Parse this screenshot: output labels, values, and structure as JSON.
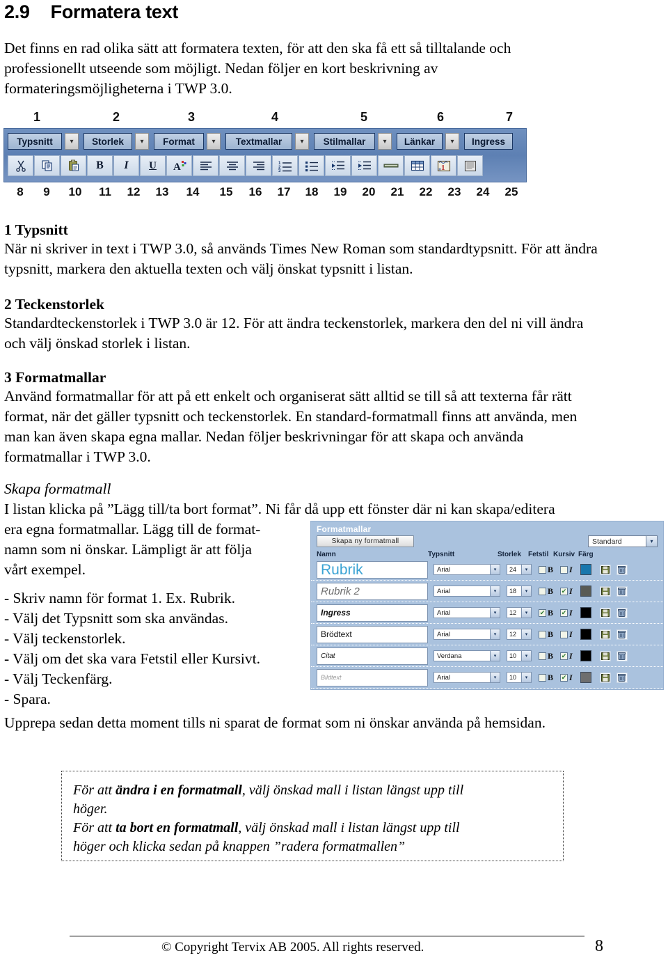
{
  "document": {
    "section_number": "2.9",
    "section_title": "Formatera text",
    "intro": "Det finns en rad olika sätt att formatera texten, för att den ska få ett så tilltalande och professionellt utseende som möjligt. Nedan följer en kort beskrivning av formateringsmöjligheterna i TWP 3.0."
  },
  "toolbar": {
    "top_numbers": [
      "1",
      "2",
      "3",
      "4",
      "5",
      "6",
      "7"
    ],
    "bottom_numbers": [
      "8",
      "9",
      "10",
      "11",
      "12",
      "13",
      "14",
      "15",
      "16",
      "17",
      "18",
      "19",
      "20",
      "21",
      "22",
      "23",
      "24",
      "25"
    ],
    "dropdowns": [
      {
        "label": "Typsnitt",
        "has_arrow": true
      },
      {
        "label": "Storlek",
        "has_arrow": true
      },
      {
        "label": "Format",
        "has_arrow": true
      },
      {
        "label": "Textmallar",
        "has_arrow": true
      },
      {
        "label": "Stilmallar",
        "has_arrow": true
      },
      {
        "label": "Länkar",
        "has_arrow": true
      },
      {
        "label": "Ingress",
        "has_arrow": false
      }
    ],
    "buttons": [
      "cut-scissors-icon",
      "copy-icon",
      "paste-clipboard-icon",
      "bold-icon",
      "italic-icon",
      "underline-icon",
      "font-color-icon",
      "align-left-icon",
      "align-center-icon",
      "align-right-icon",
      "numbered-list-icon",
      "bulleted-list-icon",
      "decrease-indent-icon",
      "increase-indent-icon",
      "horizontal-rule-icon",
      "insert-table-icon",
      "insert-image-icon",
      "page-properties-icon"
    ]
  },
  "sections": [
    {
      "heading": "1 Typsnitt",
      "body": "När ni skriver in text i TWP 3.0, så används Times New Roman som standardtypsnitt. För att ändra typsnitt, markera den aktuella texten och välj önskat typsnitt i listan."
    },
    {
      "heading": "2 Teckenstorlek",
      "body": "Standardteckenstorlek i TWP 3.0 är 12. För att ändra teckenstorlek, markera den del ni vill ändra och välj önskad storlek i listan."
    },
    {
      "heading": "3 Formatmallar",
      "body": "Använd formatmallar för att på ett enkelt och organiserat sätt alltid se till så att texterna får rätt format, när det gäller typsnitt och teckenstorlek. En standard-formatmall finns att använda, men man kan även skapa egna mallar. Nedan följer beskrivningar för att skapa och använda formatmallar i TWP 3.0."
    }
  ],
  "skapa": {
    "subheading": "Skapa formatmall",
    "line1": "I listan klicka på ”Lägg till/ta bort format”. Ni får då upp ett fönster där ni kan skapa/editera",
    "line2": "era egna formatmallar. Lägg till de format-",
    "line3": "namn som ni önskar. Lämpligt är att följa",
    "line4": "vårt exempel.",
    "steps": [
      "- Skriv namn för format 1. Ex. Rubrik.",
      "- Välj det Typsnitt som ska användas.",
      "- Välj teckenstorlek.",
      "- Välj om det ska vara Fetstil eller Kursivt.",
      "- Välj Teckenfärg.",
      "- Spara."
    ]
  },
  "formatmallar_dialog": {
    "title": "Formatmallar",
    "new_button": "Skapa ny formatmall",
    "template_select": "Standard",
    "columns": [
      "Namn",
      "Typsnitt",
      "Storlek",
      "Fetstil",
      "Kursiv",
      "Färg"
    ],
    "bold_label": "B",
    "italic_label": "I",
    "rows": [
      {
        "name": "Rubrik",
        "font": "Arial",
        "size": "24",
        "bold": false,
        "italic": false,
        "color": "#1877ad",
        "name_style": "big-blue"
      },
      {
        "name": "Rubrik 2",
        "font": "Arial",
        "size": "18",
        "bold": false,
        "italic": true,
        "color": "#595b55",
        "name_style": "med-italic-gray"
      },
      {
        "name": "Ingress",
        "font": "Arial",
        "size": "12",
        "bold": true,
        "italic": true,
        "color": "#000000",
        "name_style": "small-bold-italic"
      },
      {
        "name": "Brödtext",
        "font": "Arial",
        "size": "12",
        "bold": false,
        "italic": false,
        "color": "#000000",
        "name_style": "small-plain"
      },
      {
        "name": "Citat",
        "font": "Verdana",
        "size": "10",
        "bold": false,
        "italic": true,
        "color": "#000000",
        "name_style": "tiny-italic"
      },
      {
        "name": "Bildtext",
        "font": "Arial",
        "size": "10",
        "bold": false,
        "italic": true,
        "color": "#6e6e6e",
        "name_style": "tiny-italic-gray"
      }
    ],
    "save_icon": "save-disk-icon",
    "delete_icon": "trash-can-icon"
  },
  "closing_line": "Upprepa sedan detta moment tills ni sparat de format som ni önskar använda på hemsidan.",
  "note_box": {
    "l1a": "För att ",
    "l1b": "ändra i en formatmall",
    "l1c": ", välj önskad mall i listan längst upp till",
    "l2": "höger.",
    "l3a": "För att ",
    "l3b": "ta bort en formatmall",
    "l3c": ", välj önskad mall i listan längst upp till",
    "l4": "höger och klicka sedan på knappen ”radera formatmallen”"
  },
  "footer": {
    "copyright": "© Copyright Tervix AB 2005. All rights reserved.",
    "page_number": "8"
  },
  "colors": {
    "toolbar_band": "#5e82b5",
    "dialog_bg": "#aac2de",
    "dialog_title": "#ffffff"
  }
}
